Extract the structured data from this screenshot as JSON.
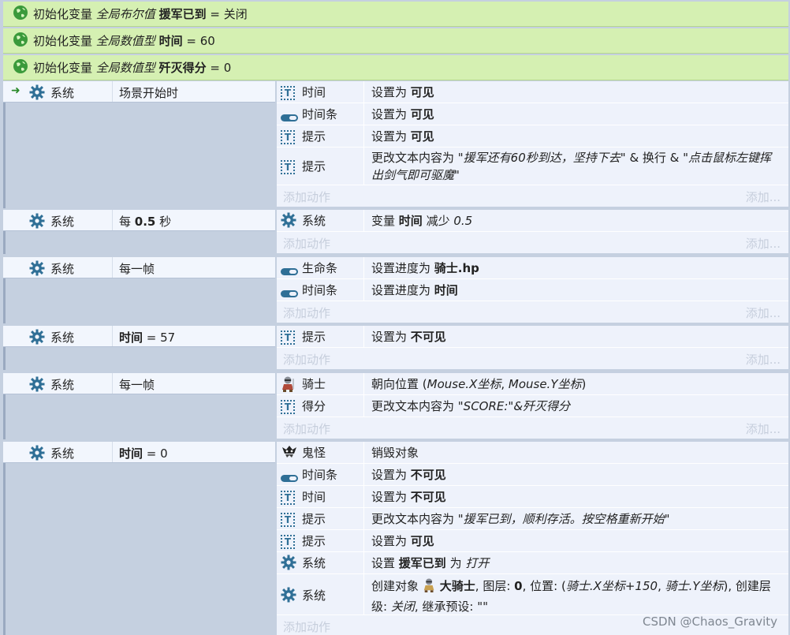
{
  "globals": [
    {
      "prefix": "初始化变量",
      "kind": "全局布尔值",
      "name": "援军已到",
      "eq": "= 关闭"
    },
    {
      "prefix": "初始化变量",
      "kind": "全局数值型",
      "name": "时间",
      "eq": "= 60"
    },
    {
      "prefix": "初始化变量",
      "kind": "全局数值型",
      "name": "歼灭得分",
      "eq": "= 0"
    }
  ],
  "events": [
    {
      "object": "系统",
      "condition": "场景开始时",
      "actions": [
        {
          "icon": "text-icon",
          "name": "时间",
          "t1": "设置为 ",
          "b1": "可见"
        },
        {
          "icon": "bar-icon",
          "name": "时间条",
          "t1": "设置为 ",
          "b1": "可见"
        },
        {
          "icon": "text-icon",
          "name": "提示",
          "t1": "设置为 ",
          "b1": "可见"
        },
        {
          "icon": "text-icon",
          "name": "提示",
          "t1": "更改文本内容为 ",
          "i1": "\"援军还有60秒到达，坚持下去\"",
          "t2": " & 换行 & ",
          "i2": "\"点击鼠标左键挥出剑气即可驱魔\""
        }
      ]
    },
    {
      "object": "系统",
      "condition_pre": "每 ",
      "condition_bold": "0.5",
      "condition_post": " 秒",
      "actions": [
        {
          "icon": "gear-icon",
          "name": "系统",
          "t1": "变量 ",
          "b1": "时间",
          "t2": " 减少 ",
          "i1": "0.5"
        }
      ]
    },
    {
      "object": "系统",
      "condition": "每一帧",
      "actions": [
        {
          "icon": "bar-icon",
          "name": "生命条",
          "t1": "设置进度为 ",
          "b1": "骑士.hp"
        },
        {
          "icon": "bar-icon",
          "name": "时间条",
          "t1": "设置进度为 ",
          "b1": "时间"
        }
      ]
    },
    {
      "object": "系统",
      "condition_bold": "时间",
      "condition_post": " = 57",
      "actions": [
        {
          "icon": "text-icon",
          "name": "提示",
          "t1": "设置为 ",
          "b1": "不可见"
        }
      ]
    },
    {
      "object": "系统",
      "condition": "每一帧",
      "actions": [
        {
          "icon": "knight-icon",
          "name": "骑士",
          "t1": "朝向位置 (",
          "i1": "Mouse.X坐标",
          "t2": ", ",
          "i2": "Mouse.Y坐标",
          "t3": ")"
        },
        {
          "icon": "text-icon",
          "name": "得分",
          "t1": "更改文本内容为 ",
          "i1": "\"SCORE:\"&歼灭得分"
        }
      ]
    },
    {
      "object": "系统",
      "condition_bold": "时间",
      "condition_post": " = 0",
      "actions": [
        {
          "icon": "ghost-icon",
          "name": "鬼怪",
          "t1": "销毁对象"
        },
        {
          "icon": "bar-icon",
          "name": "时间条",
          "t1": "设置为 ",
          "b1": "不可见"
        },
        {
          "icon": "text-icon",
          "name": "时间",
          "t1": "设置为 ",
          "b1": "不可见"
        },
        {
          "icon": "text-icon",
          "name": "提示",
          "t1": "更改文本内容为 ",
          "i1": "\"援军已到，顺利存活。按空格重新开始\""
        },
        {
          "icon": "text-icon",
          "name": "提示",
          "t1": "设置为 ",
          "b1": "可见"
        },
        {
          "icon": "gear-icon",
          "name": "系统",
          "t1": "设置 ",
          "b1": "援军已到",
          "t2": " 为 ",
          "i1": "打开"
        },
        {
          "icon": "gear-icon",
          "name": "系统",
          "t1": "创建对象 ",
          "b1": "大骑士",
          "t2": ", 图层: ",
          "b2": "0",
          "t3": ", 位置: (",
          "i1": "骑士.X坐标+150",
          "t4": ", ",
          "i2": "骑士.Y坐标",
          "t5": "), 创建层级: ",
          "i3": "关闭",
          "t6": ", 继承预设: ",
          "i4": "\"\""
        }
      ]
    }
  ],
  "labels": {
    "add_action": "添加动作",
    "add_more": "添加..."
  },
  "watermark": "CSDN @Chaos_Gravity",
  "colors": {
    "global_bg": "#d5f0b2",
    "event_bg": "#c5d0e0",
    "action_bg": "#eef2fb",
    "accent": "#2f6f96"
  }
}
